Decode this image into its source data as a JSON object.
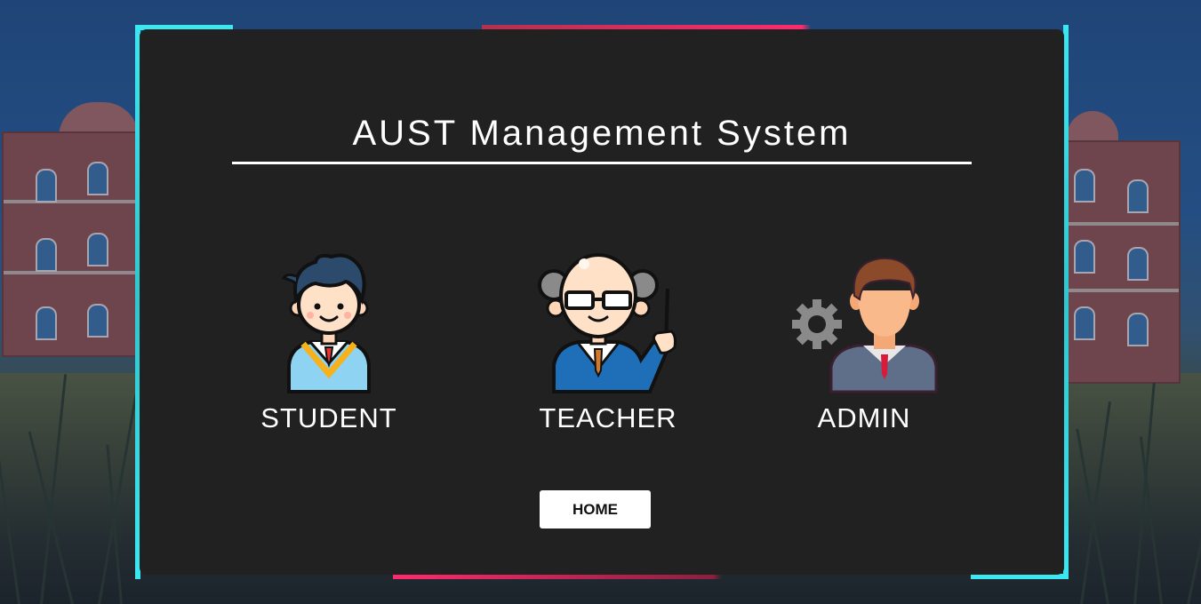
{
  "app": {
    "title": "AUST Management System"
  },
  "roles": [
    {
      "label": "STUDENT",
      "icon": "student-icon"
    },
    {
      "label": "TEACHER",
      "icon": "teacher-icon"
    },
    {
      "label": "ADMIN",
      "icon": "admin-icon"
    }
  ],
  "home_button": {
    "label": "HOME"
  },
  "colors": {
    "card_background": "#212121",
    "frame_cyan": "#3be7f1",
    "frame_pink": "#ff2a6d",
    "text": "#ffffff",
    "button_background": "#ffffff"
  }
}
